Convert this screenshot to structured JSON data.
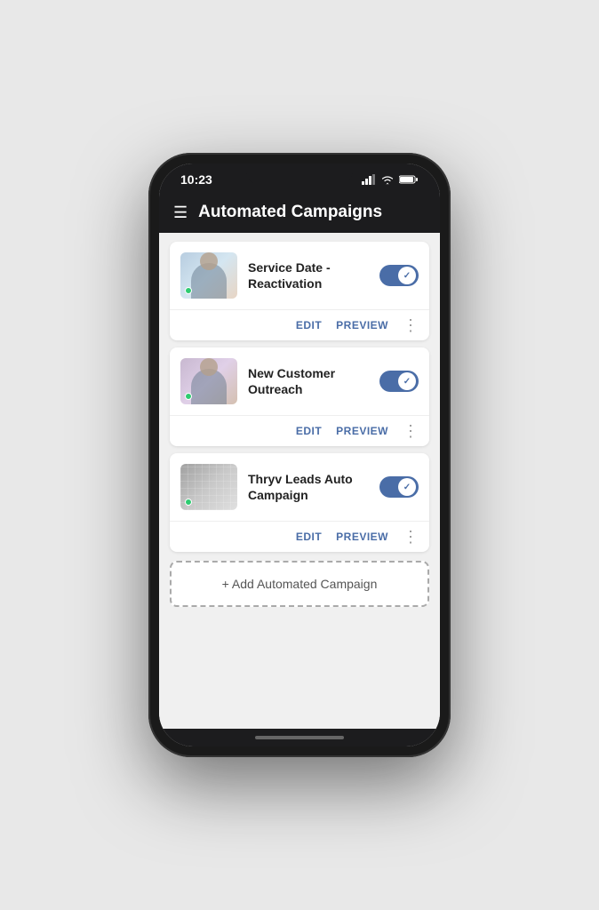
{
  "status_bar": {
    "time": "10:23",
    "signal": "▲",
    "wifi": "WiFi",
    "battery": "Battery"
  },
  "header": {
    "menu_icon": "☰",
    "title": "Automated Campaigns"
  },
  "campaigns": [
    {
      "id": 1,
      "name": "Service Date -\nReactivation",
      "name_display": "Service Date - Reactivation",
      "thumb_class": "thumb-1",
      "enabled": true,
      "edit_label": "EDIT",
      "preview_label": "PREVIEW"
    },
    {
      "id": 2,
      "name": "New Customer Outreach",
      "name_display": "New Customer Outreach",
      "thumb_class": "thumb-2",
      "enabled": true,
      "edit_label": "EDIT",
      "preview_label": "PREVIEW"
    },
    {
      "id": 3,
      "name": "Thryv Leads Auto Campaign",
      "name_display": "Thryv Leads Auto Campaign",
      "thumb_class": "thumb-3",
      "enabled": true,
      "edit_label": "EDIT",
      "preview_label": "PREVIEW"
    }
  ],
  "add_button": {
    "label": "+ Add Automated Campaign"
  }
}
